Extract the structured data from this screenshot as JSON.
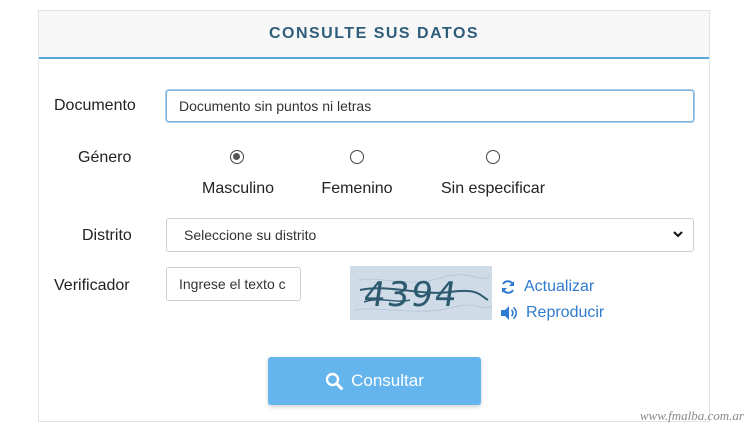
{
  "header": {
    "title": "CONSULTE SUS DATOS"
  },
  "form": {
    "documento": {
      "label": "Documento",
      "value": "Documento sin puntos ni letras"
    },
    "genero": {
      "label": "Género",
      "options": [
        {
          "label": "Masculino",
          "checked": true
        },
        {
          "label": "Femenino",
          "checked": false
        },
        {
          "label": "Sin especificar",
          "checked": false
        }
      ]
    },
    "distrito": {
      "label": "Distrito",
      "selected": "Seleccione su distrito"
    },
    "verificador": {
      "label": "Verificador",
      "placeholder": "Ingrese el texto c",
      "captcha_text": "4394",
      "refresh_label": "Actualizar",
      "play_label": "Reproducir"
    },
    "submit_label": "Consultar"
  },
  "watermark": "www.fmalba.com.ar",
  "colors": {
    "accent": "#5aa7d8",
    "button": "#64b4ee",
    "link": "#2f7bd0",
    "title": "#2f5d7c"
  },
  "icons": {
    "refresh": "refresh-icon",
    "audio": "speaker-icon",
    "search": "search-icon"
  }
}
